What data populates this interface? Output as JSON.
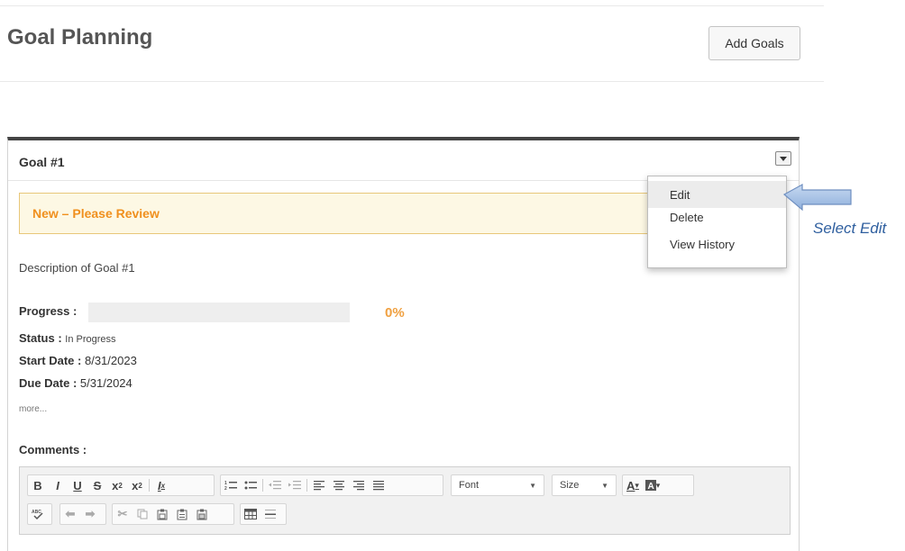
{
  "header": {
    "title": "Goal Planning",
    "add_button": "Add Goals"
  },
  "goal": {
    "title": "Goal #1",
    "status_banner": "New – Please Review",
    "description": "Description of Goal #1",
    "progress_label": "Progress :",
    "progress_percent": "0%",
    "progress_value": 0,
    "status_label": "Status :",
    "status_value": "In Progress",
    "start_label": "Start Date :",
    "start_value": "8/31/2023",
    "due_label": "Due Date :",
    "due_value": "5/31/2024",
    "more_link": "more...",
    "comments_label": "Comments :"
  },
  "menu": {
    "items": [
      {
        "label": "Edit",
        "active": true
      },
      {
        "label": "Delete",
        "active": false
      },
      {
        "label": "View History",
        "active": false
      }
    ]
  },
  "callout": {
    "text": "Select Edit",
    "color": "#2f5f9f"
  },
  "editor": {
    "font_combo": "Font",
    "size_combo": "Size",
    "buttons_row1": [
      "bold",
      "italic",
      "underline",
      "strikethrough",
      "subscript",
      "superscript",
      "remove-format",
      "numbered-list",
      "bulleted-list",
      "decrease-indent",
      "increase-indent",
      "align-left",
      "align-center",
      "align-right",
      "justify",
      "text-color",
      "background-color"
    ],
    "buttons_row2": [
      "spell-check",
      "undo",
      "redo",
      "cut",
      "copy",
      "paste",
      "paste-text",
      "paste-word",
      "table",
      "horizontal-line"
    ]
  },
  "colors": {
    "accent_orange": "#f0901e",
    "banner_bg": "#fdf8e4",
    "card_border_top": "#444444"
  }
}
